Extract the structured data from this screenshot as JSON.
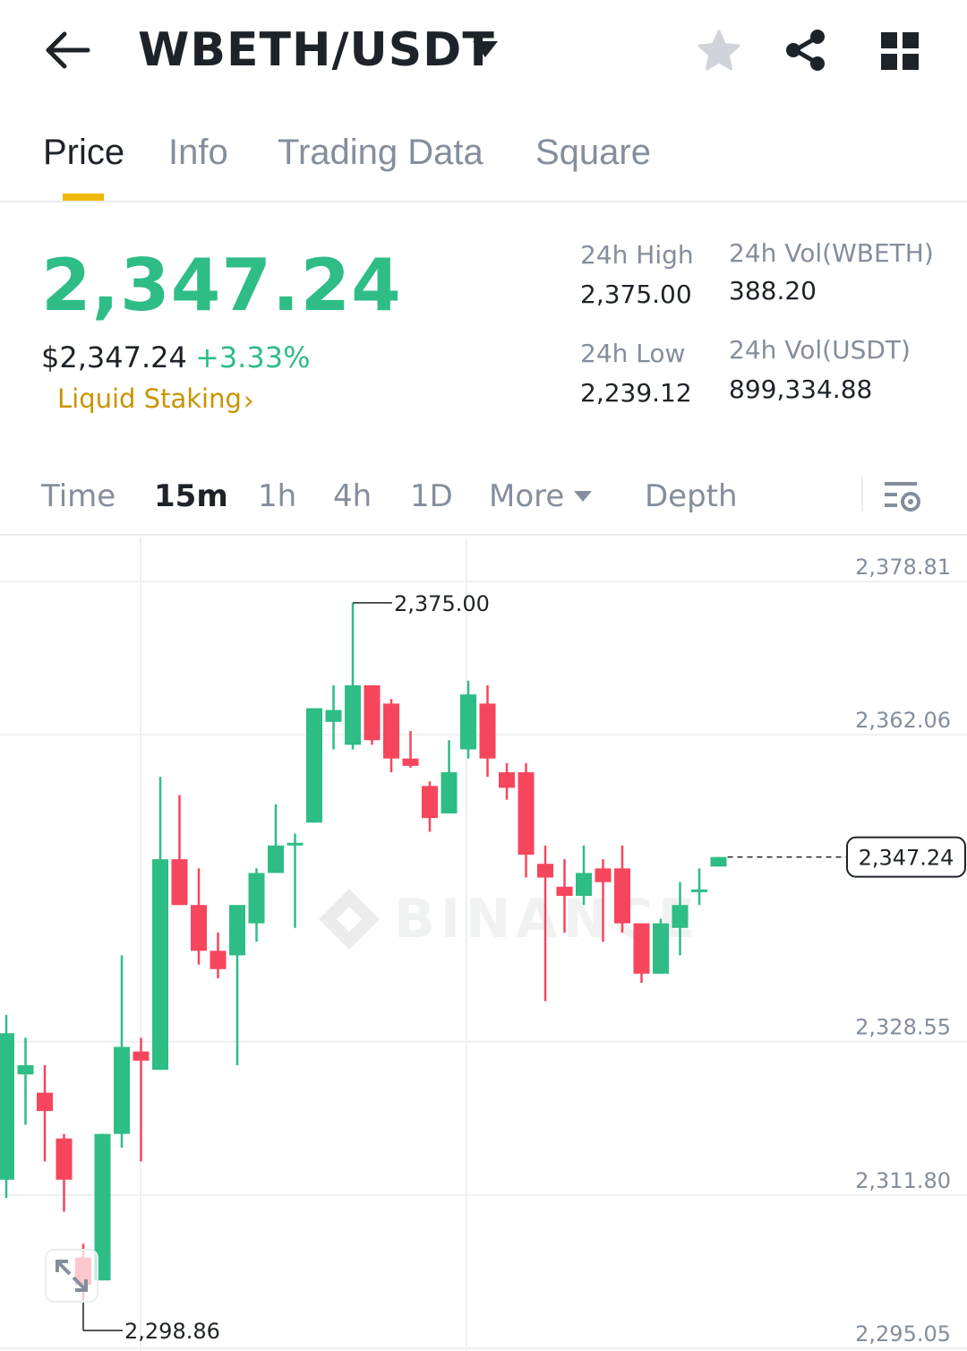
{
  "header": {
    "pair": "WBETH/USDT",
    "icons": [
      "back-arrow-icon",
      "caret-down-icon",
      "star-icon",
      "share-icon",
      "grid-icon"
    ]
  },
  "tabs": [
    {
      "label": "Price",
      "active": true
    },
    {
      "label": "Info",
      "active": false
    },
    {
      "label": "Trading Data",
      "active": false
    },
    {
      "label": "Square",
      "active": false
    }
  ],
  "ticker": {
    "last_price": "2,347.24",
    "usd_price": "$2,347.24",
    "change_pct": "+3.33%",
    "tag": "Liquid Staking",
    "tag_chevron": "›",
    "high_label": "24h High",
    "high_value": "2,375.00",
    "low_label": "24h Low",
    "low_value": "2,239.12",
    "vol_base_label": "24h Vol(WBETH)",
    "vol_base_value": "388.20",
    "vol_quote_label": "24h Vol(USDT)",
    "vol_quote_value": "899,334.88"
  },
  "intervals": {
    "items": [
      "Time",
      "15m",
      "1h",
      "4h",
      "1D",
      "More",
      "Depth"
    ],
    "active": "15m"
  },
  "colors": {
    "up": "#2ebd85",
    "down": "#f6465d",
    "accent": "#f0b90b",
    "tag": "#c99400",
    "muted": "#848e9c",
    "text": "#1e2329"
  },
  "chart_data": {
    "type": "candlestick",
    "y_ticks": [
      "2,378.81",
      "2,362.06",
      "2,328.55",
      "2,311.80",
      "2,295.05"
    ],
    "ylim": [
      2295.05,
      2378.81
    ],
    "high_marker": "2,375.00",
    "low_marker": "2,298.86",
    "last_price_label": "2,347.24",
    "watermark": "BINANCE",
    "candles": [
      {
        "o": 2312.0,
        "c": 2328.0,
        "h": 2330.0,
        "l": 2310.0
      },
      {
        "o": 2323.5,
        "c": 2324.5,
        "h": 2327.5,
        "l": 2318.0
      },
      {
        "o": 2321.5,
        "c": 2319.5,
        "h": 2324.5,
        "l": 2314.0
      },
      {
        "o": 2316.5,
        "c": 2312.0,
        "h": 2317.0,
        "l": 2308.5
      },
      {
        "o": 2303.5,
        "c": 2300.5,
        "h": 2305.0,
        "l": 2298.86
      },
      {
        "o": 2301.0,
        "c": 2317.0,
        "h": 2317.0,
        "l": 2301.0
      },
      {
        "o": 2317.0,
        "c": 2326.5,
        "h": 2336.5,
        "l": 2315.5
      },
      {
        "o": 2326.0,
        "c": 2325.0,
        "h": 2327.5,
        "l": 2314.0
      },
      {
        "o": 2324.0,
        "c": 2347.0,
        "h": 2356.0,
        "l": 2324.0
      },
      {
        "o": 2347.0,
        "c": 2342.0,
        "h": 2354.0,
        "l": 2342.0
      },
      {
        "o": 2342.0,
        "c": 2337.0,
        "h": 2346.0,
        "l": 2335.5
      },
      {
        "o": 2337.0,
        "c": 2335.0,
        "h": 2339.0,
        "l": 2334.0
      },
      {
        "o": 2336.5,
        "c": 2342.0,
        "h": 2342.0,
        "l": 2324.5
      },
      {
        "o": 2340.0,
        "c": 2345.5,
        "h": 2346.0,
        "l": 2338.0
      },
      {
        "o": 2345.5,
        "c": 2348.5,
        "h": 2353.0,
        "l": 2345.5
      },
      {
        "o": 2348.5,
        "c": 2348.8,
        "h": 2349.8,
        "l": 2339.5
      },
      {
        "o": 2351.0,
        "c": 2363.5,
        "h": 2363.5,
        "l": 2351.0
      },
      {
        "o": 2362.0,
        "c": 2363.3,
        "h": 2366.0,
        "l": 2359.0
      },
      {
        "o": 2359.5,
        "c": 2366.0,
        "h": 2375.0,
        "l": 2359.0
      },
      {
        "o": 2366.0,
        "c": 2360.0,
        "h": 2366.0,
        "l": 2359.5
      },
      {
        "o": 2364.0,
        "c": 2358.0,
        "h": 2364.5,
        "l": 2356.5
      },
      {
        "o": 2358.0,
        "c": 2357.2,
        "h": 2361.0,
        "l": 2357.0
      },
      {
        "o": 2355.0,
        "c": 2351.5,
        "h": 2355.5,
        "l": 2350.0
      },
      {
        "o": 2352.0,
        "c": 2356.5,
        "h": 2360.0,
        "l": 2352.0
      },
      {
        "o": 2359.0,
        "c": 2365.0,
        "h": 2366.5,
        "l": 2358.0
      },
      {
        "o": 2364.0,
        "c": 2358.0,
        "h": 2366.0,
        "l": 2356.0
      },
      {
        "o": 2356.5,
        "c": 2354.8,
        "h": 2357.5,
        "l": 2353.5
      },
      {
        "o": 2356.5,
        "c": 2347.5,
        "h": 2357.5,
        "l": 2345.0
      },
      {
        "o": 2346.5,
        "c": 2345.0,
        "h": 2348.5,
        "l": 2331.5
      },
      {
        "o": 2344.0,
        "c": 2343.0,
        "h": 2347.0,
        "l": 2339.0
      },
      {
        "o": 2343.0,
        "c": 2345.5,
        "h": 2348.5,
        "l": 2342.0
      },
      {
        "o": 2346.0,
        "c": 2344.5,
        "h": 2347.0,
        "l": 2338.0
      },
      {
        "o": 2346.0,
        "c": 2340.0,
        "h": 2348.5,
        "l": 2339.0
      },
      {
        "o": 2340.0,
        "c": 2334.5,
        "h": 2340.0,
        "l": 2333.5
      },
      {
        "o": 2334.5,
        "c": 2340.0,
        "h": 2340.5,
        "l": 2334.5
      },
      {
        "o": 2339.5,
        "c": 2342.0,
        "h": 2344.5,
        "l": 2336.5
      },
      {
        "o": 2343.5,
        "c": 2343.7,
        "h": 2346.0,
        "l": 2342.0
      },
      {
        "o": 2346.2,
        "c": 2347.24,
        "h": 2347.24,
        "l": 2346.2
      }
    ]
  }
}
